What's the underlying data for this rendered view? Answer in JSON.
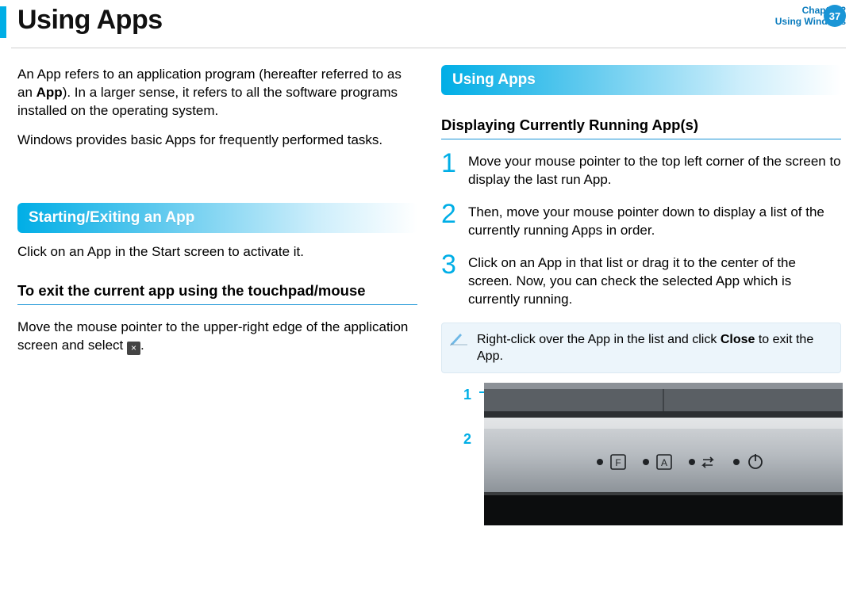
{
  "header": {
    "title": "Using Apps",
    "chapter_line": "Chapter 2",
    "section_line": "Using Windows",
    "page_number": "37"
  },
  "left": {
    "intro_1_a": "An App refers to an application program (hereafter referred to as an ",
    "intro_1_bold": "App",
    "intro_1_b": "). In a larger sense, it refers to all the software programs installed on the operating system.",
    "intro_2": "Windows provides basic Apps for frequently performed tasks.",
    "section1_title": "Starting/Exiting an App",
    "section1_text": "Click on an App in the Start screen to activate it.",
    "sub_heading": "To exit the current app using the touchpad/mouse",
    "exit_text_a": "Move the mouse pointer to the upper-right edge of the application screen and select ",
    "exit_text_b": "."
  },
  "right": {
    "section_title": "Using Apps",
    "sub_heading": "Displaying Currently Running App(s)",
    "steps": [
      {
        "n": "1",
        "t": "Move your mouse pointer to the top left corner of the screen to display the last run App."
      },
      {
        "n": "2",
        "t": "Then, move your mouse pointer down to display a list of the currently running Apps in order."
      },
      {
        "n": "3",
        "t": "Click on an App in that list or drag it to the center of the screen. Now, you can check the selected App which is currently running."
      }
    ],
    "note_a": "Right-click over the App in the list and click ",
    "note_bold": "Close",
    "note_b": " to exit the App.",
    "callouts": {
      "one": "1",
      "two": "2"
    },
    "icons": {
      "fn": "F",
      "caps": "A",
      "hdd": "⇄",
      "power": "⏻"
    }
  }
}
